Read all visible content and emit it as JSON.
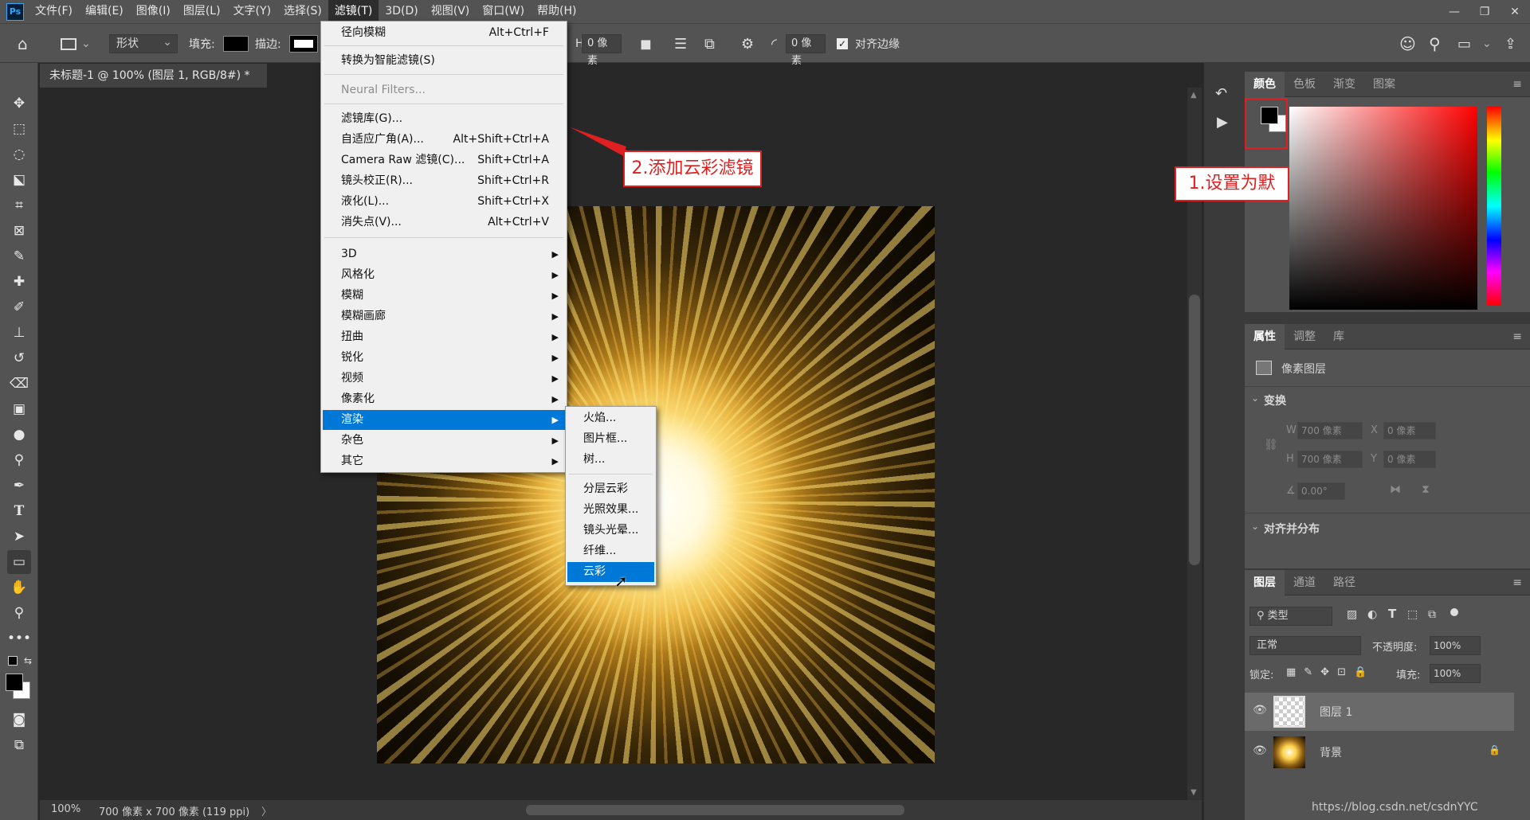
{
  "app": {
    "logo": "Ps"
  },
  "menubar": {
    "items": [
      "文件(F)",
      "编辑(E)",
      "图像(I)",
      "图层(L)",
      "文字(Y)",
      "选择(S)",
      "滤镜(T)",
      "3D(D)",
      "视图(V)",
      "窗口(W)",
      "帮助(H)"
    ],
    "active_index": 6
  },
  "options": {
    "shape_mode": "形状",
    "fill_label": "填充:",
    "stroke_label": "描边:",
    "w_value": "0 像素",
    "radius_value": "0 像素",
    "align_edges": "对齐边缘"
  },
  "document": {
    "tab_title": "未标题-1 @ 100% (图层 1, RGB/8#) *",
    "close": "×"
  },
  "status": {
    "zoom": "100%",
    "info": "700 像素 x 700 像素 (119 ppi)",
    "arrow": "〉"
  },
  "filter_menu": {
    "items": [
      {
        "label": "径向模糊",
        "shortcut": "Alt+Ctrl+F"
      },
      {
        "label": "转换为智能滤镜(S)",
        "shortcut": ""
      },
      {
        "label": "Neural Filters...",
        "shortcut": ""
      },
      {
        "label": "滤镜库(G)...",
        "shortcut": ""
      },
      {
        "label": "自适应广角(A)...",
        "shortcut": "Alt+Shift+Ctrl+A"
      },
      {
        "label": "Camera Raw 滤镜(C)...",
        "shortcut": "Shift+Ctrl+A"
      },
      {
        "label": "镜头校正(R)...",
        "shortcut": "Shift+Ctrl+R"
      },
      {
        "label": "液化(L)...",
        "shortcut": "Shift+Ctrl+X"
      },
      {
        "label": "消失点(V)...",
        "shortcut": "Alt+Ctrl+V"
      },
      {
        "label": "3D"
      },
      {
        "label": "风格化"
      },
      {
        "label": "模糊"
      },
      {
        "label": "模糊画廊"
      },
      {
        "label": "扭曲"
      },
      {
        "label": "锐化"
      },
      {
        "label": "视频"
      },
      {
        "label": "像素化"
      },
      {
        "label": "渲染"
      },
      {
        "label": "杂色"
      },
      {
        "label": "其它"
      }
    ],
    "submenu_arrow": "▶"
  },
  "render_submenu": {
    "items": [
      "火焰...",
      "图片框...",
      "树...",
      "分层云彩",
      "光照效果...",
      "镜头光晕...",
      "纤维...",
      "云彩"
    ],
    "highlighted": "云彩"
  },
  "annotations": {
    "callout1": "1.设置为默",
    "callout2": "2.添加云彩滤镜"
  },
  "color_panel": {
    "tabs": [
      "颜色",
      "色板",
      "渐变",
      "图案"
    ]
  },
  "properties_panel": {
    "tabs": [
      "属性",
      "调整",
      "库"
    ],
    "pixel_layer": "像素图层",
    "transform": "变换",
    "w_label": "W",
    "w_value": "700 像素",
    "x_label": "X",
    "x_value": "0 像素",
    "h_label": "H",
    "h_value": "700 像素",
    "y_label": "Y",
    "y_value": "0 像素",
    "angle_value": "0.00°",
    "align": "对齐并分布"
  },
  "layers_panel": {
    "tabs": [
      "图层",
      "通道",
      "路径"
    ],
    "filter_kind": "类型",
    "blend_mode": "正常",
    "opacity_label": "不透明度:",
    "opacity_value": "100%",
    "lock_label": "锁定:",
    "fill_label": "填充:",
    "fill_value": "100%",
    "layers": [
      {
        "name": "图层 1"
      },
      {
        "name": "背景"
      }
    ]
  },
  "watermark": "https://blog.csdn.net/csdnYYC",
  "colors": {
    "accent": "#0078d7",
    "annotation_red": "#e02020"
  }
}
